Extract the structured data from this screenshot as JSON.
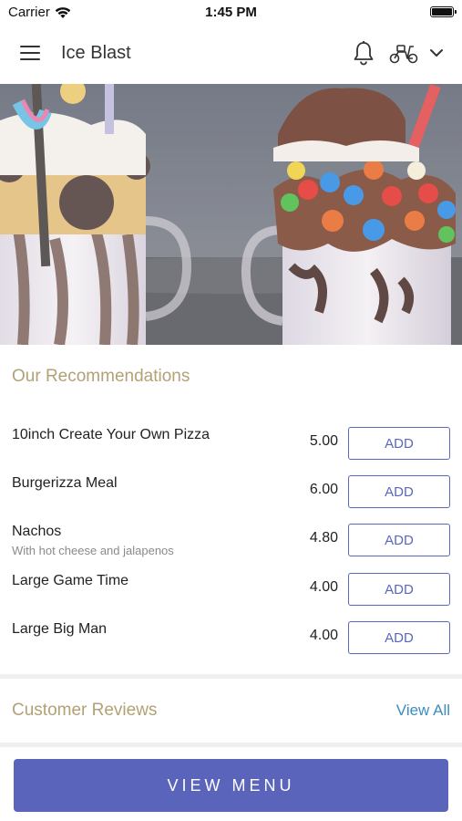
{
  "status_bar": {
    "carrier": "Carrier",
    "time": "1:45 PM",
    "icons": [
      "wifi-icon",
      "battery-icon"
    ]
  },
  "header": {
    "title": "Ice Blast",
    "icons": [
      "hamburger-menu-icon",
      "bell-icon",
      "scooter-icon",
      "chevron-down-icon"
    ]
  },
  "hero": {
    "image": "milkshake-freakshakes-photo"
  },
  "recommendations": {
    "title": "Our Recommendations",
    "add_label": "ADD",
    "items": [
      {
        "name": "10inch Create Your Own Pizza",
        "description": "",
        "price": "5.00"
      },
      {
        "name": "Burgerizza Meal",
        "description": "",
        "price": "6.00"
      },
      {
        "name": "Nachos",
        "description": "With hot cheese and jalapenos",
        "price": "4.80"
      },
      {
        "name": "Large Game Time",
        "description": "",
        "price": "4.00"
      },
      {
        "name": "Large Big Man",
        "description": "",
        "price": "4.00"
      }
    ]
  },
  "reviews": {
    "title": "Customer Reviews",
    "view_all": "View All"
  },
  "footer": {
    "view_menu": "VIEW MENU"
  },
  "colors": {
    "accent": "#5964ba",
    "section_title": "#b3a176",
    "link": "#3d8cc0"
  }
}
